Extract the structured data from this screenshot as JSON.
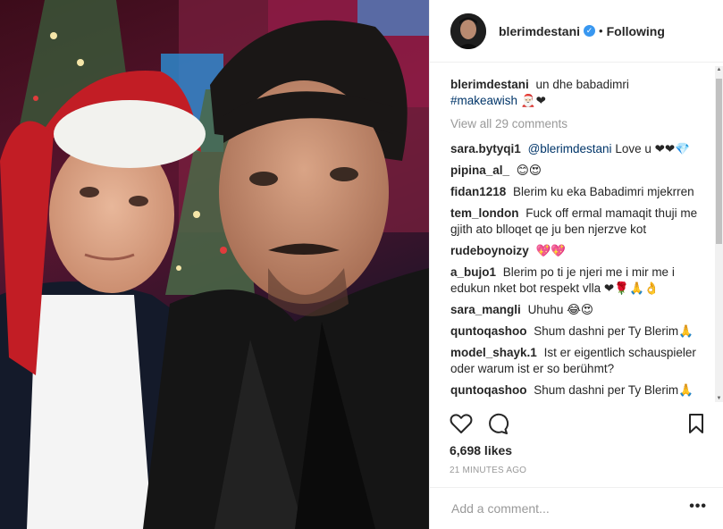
{
  "post": {
    "username": "blerimdestani",
    "follow_status": "Following",
    "separator": "•",
    "caption_user": "blerimdestani",
    "caption_text": "un dhe babadimri",
    "caption_hashtag": "#makeawish",
    "caption_emoji": "🎅🏻❤",
    "view_all": "View all 29 comments",
    "likes": "6,698 likes",
    "time_ago": "21 MINUTES AGO",
    "add_comment_placeholder": "Add a comment...",
    "more_label": "•••"
  },
  "comments": [
    {
      "user": "sara.bytyqi1",
      "mention": "@blerimdestani",
      "text": "Love u ❤❤💎"
    },
    {
      "user": "pipina_al_",
      "mention": "",
      "text": "😊😍"
    },
    {
      "user": "fidan1218",
      "mention": "",
      "text": "Blerim ku eka Babadimri mjekrren"
    },
    {
      "user": "tem_london",
      "mention": "",
      "text": "Fuck off ermal mamaqit thuji me gjith ato blloqet qe ju ben njerzve kot"
    },
    {
      "user": "rudeboynoizy",
      "mention": "",
      "text": "💖💖"
    },
    {
      "user": "a_bujo1",
      "mention": "",
      "text": "Blerim po ti je njeri me i mir me i edukun nket bot respekt vlla ❤🌹🙏👌"
    },
    {
      "user": "sara_mangli",
      "mention": "",
      "text": "Uhuhu 😂😍"
    },
    {
      "user": "quntoqashoo",
      "mention": "",
      "text": "Shum dashni per Ty Blerim🙏"
    },
    {
      "user": "model_shayk.1",
      "mention": "",
      "text": "Ist er eigentlich schauspieler oder warum ist er so berühmt?"
    },
    {
      "user": "quntoqashoo",
      "mention": "",
      "text": "Shum dashni per Ty Blerim🙏"
    }
  ],
  "icons": {
    "like": "heart-icon",
    "comment": "comment-icon",
    "save": "bookmark-icon",
    "verified": "verified-badge-icon"
  },
  "colors": {
    "link": "#003569",
    "verified": "#3897f0",
    "muted": "#999999",
    "text": "#262626"
  }
}
